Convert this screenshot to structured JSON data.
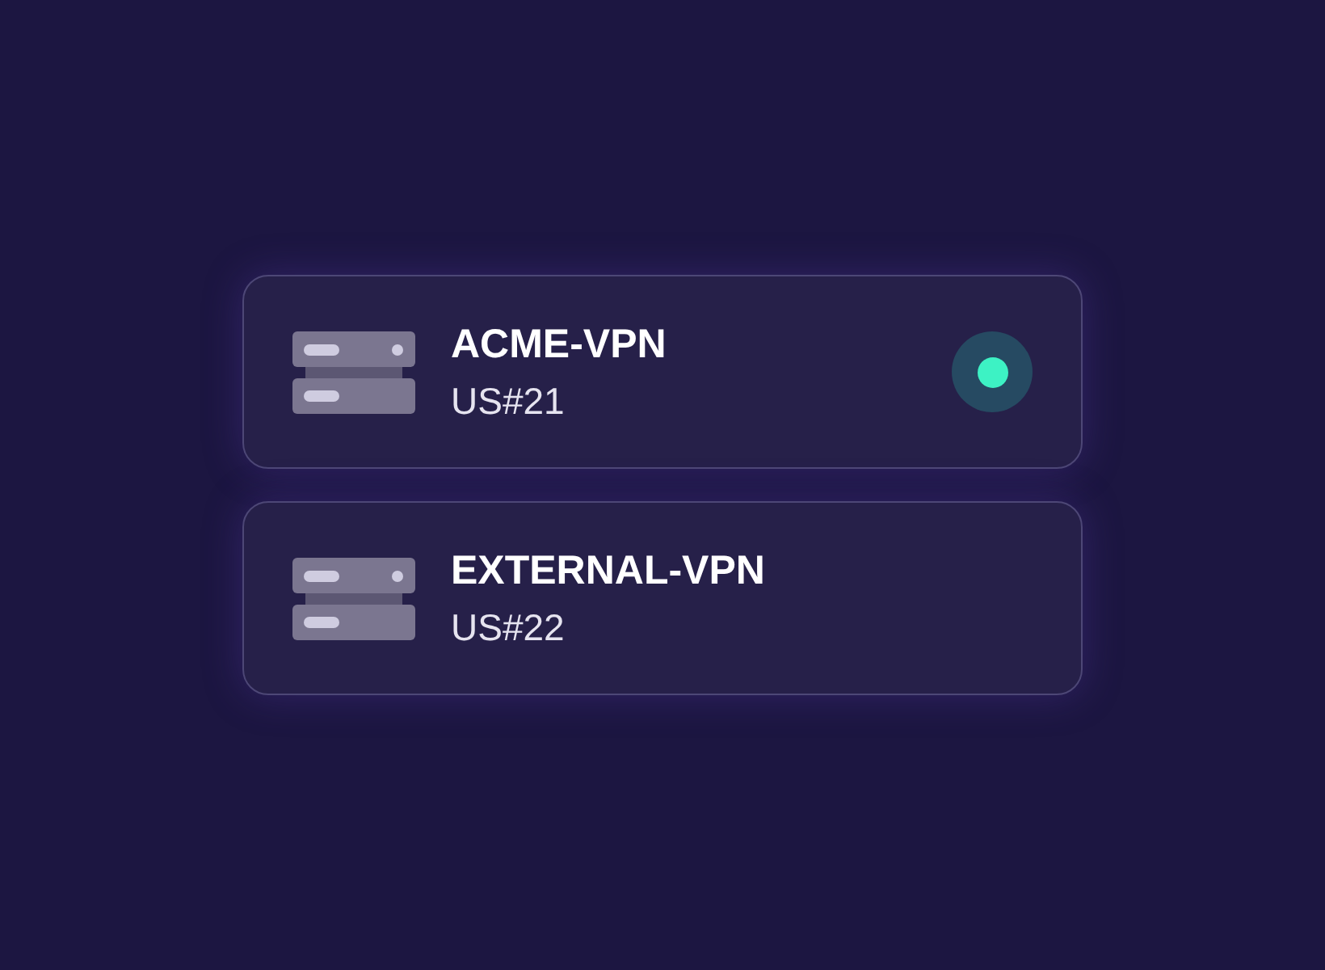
{
  "servers": [
    {
      "name": "ACME-VPN",
      "location": "US#21",
      "connected": true
    },
    {
      "name": "EXTERNAL-VPN",
      "location": "US#22",
      "connected": false
    }
  ]
}
